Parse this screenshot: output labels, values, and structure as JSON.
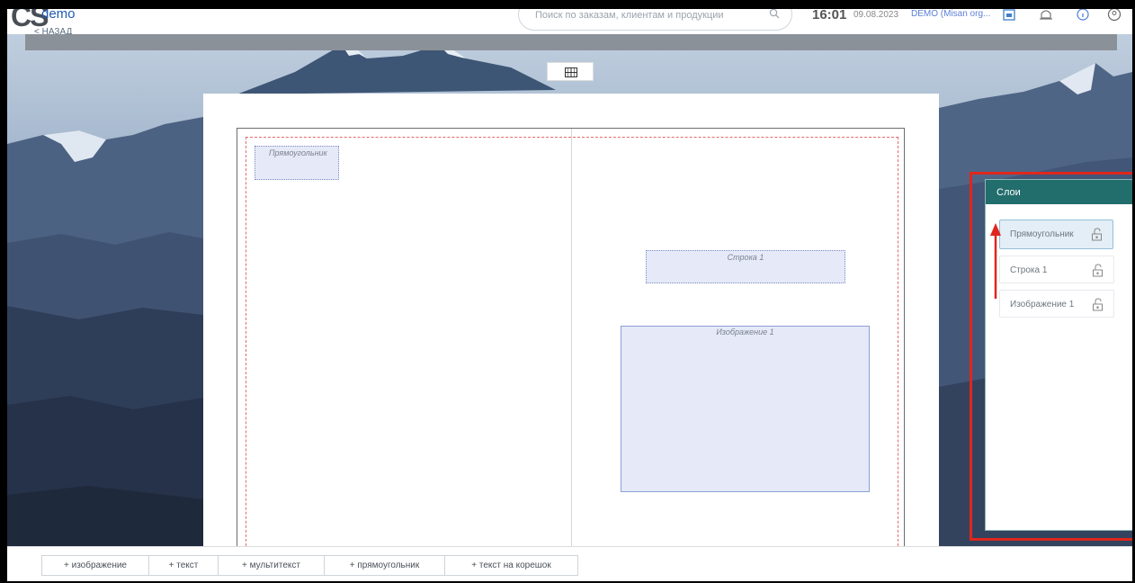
{
  "header": {
    "logo_text": "CS",
    "brand": "demo",
    "back_link": "< НАЗАД",
    "search_placeholder": "Поиск по заказам, клиентам и продукции",
    "time": "16:01",
    "date": "09.08.2023",
    "user": "DEMO (Misan org...",
    "icons": [
      "screen-icon",
      "bell-icon",
      "info-icon",
      "account-icon"
    ]
  },
  "canvas": {
    "grid_toggle_icon": "grid-icon",
    "objects": [
      {
        "label": "Прямоугольник"
      },
      {
        "label": "Строка 1"
      },
      {
        "label": "Изображение 1"
      }
    ]
  },
  "layers_panel": {
    "title": "Слои",
    "items": [
      {
        "label": "Прямоугольник",
        "selected": true
      },
      {
        "label": "Строка 1",
        "selected": false
      },
      {
        "label": "Изображение 1",
        "selected": false
      }
    ],
    "lock_icon": "unlock-icon"
  },
  "annotation": {
    "highlight_color": "#e0261c",
    "arrow_color": "#e0261c"
  },
  "toolbar": {
    "buttons": [
      "+ изображение",
      "+ текст",
      "+ мультитекст",
      "+ прямоугольник",
      "+ текст на корешок"
    ]
  },
  "colors": {
    "panel_header": "#226e6c",
    "object_fill": "#e6eaf8",
    "safe_zone": "#e26a6a"
  }
}
